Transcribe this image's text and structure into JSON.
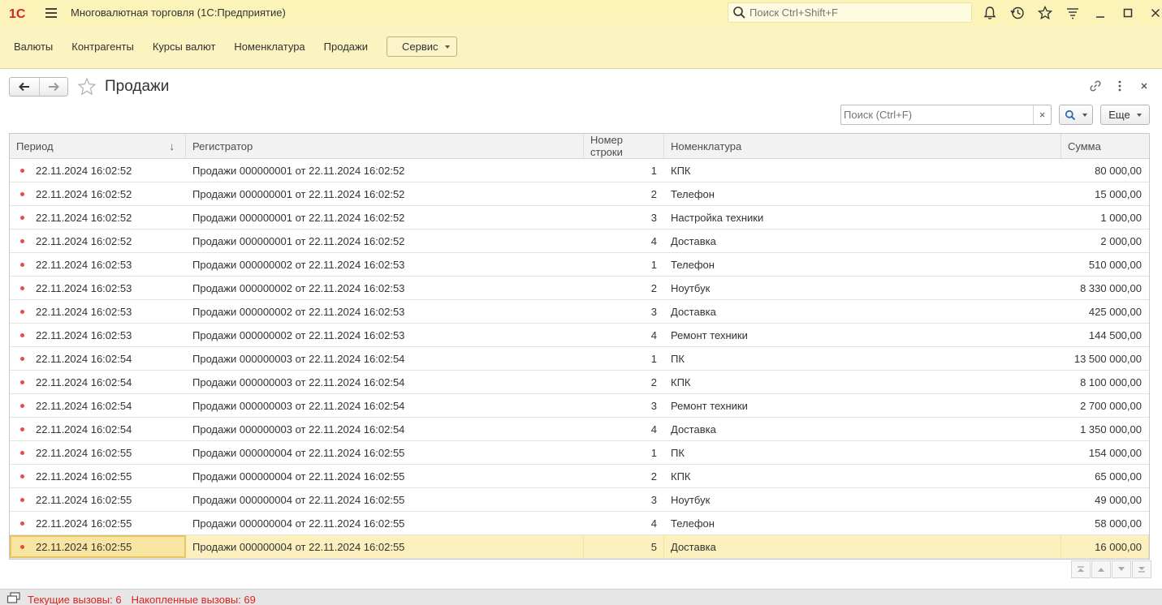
{
  "app": {
    "title": "Многовалютная торговля  (1С:Предприятие)",
    "global_search_placeholder": "Поиск Ctrl+Shift+F",
    "logo_text": "1С"
  },
  "sections": {
    "items": [
      "Валюты",
      "Контрагенты",
      "Курсы валют",
      "Номенклатура",
      "Продажи"
    ],
    "service_label": "Сервис"
  },
  "form": {
    "title": "Продажи",
    "search_placeholder": "Поиск (Ctrl+F)",
    "clear_label": "×",
    "more_label": "Еще"
  },
  "table": {
    "columns": [
      "Период",
      "Регистратор",
      "Номер строки",
      "Номенклатура",
      "Сумма"
    ],
    "sort_indicator": "↓",
    "rows": [
      [
        "22.11.2024 16:02:52",
        "Продажи 000000001 от 22.11.2024 16:02:52",
        "1",
        "КПК",
        "80 000,00"
      ],
      [
        "22.11.2024 16:02:52",
        "Продажи 000000001 от 22.11.2024 16:02:52",
        "2",
        "Телефон",
        "15 000,00"
      ],
      [
        "22.11.2024 16:02:52",
        "Продажи 000000001 от 22.11.2024 16:02:52",
        "3",
        "Настройка техники",
        "1 000,00"
      ],
      [
        "22.11.2024 16:02:52",
        "Продажи 000000001 от 22.11.2024 16:02:52",
        "4",
        "Доставка",
        "2 000,00"
      ],
      [
        "22.11.2024 16:02:53",
        "Продажи 000000002 от 22.11.2024 16:02:53",
        "1",
        "Телефон",
        "510 000,00"
      ],
      [
        "22.11.2024 16:02:53",
        "Продажи 000000002 от 22.11.2024 16:02:53",
        "2",
        "Ноутбук",
        "8 330 000,00"
      ],
      [
        "22.11.2024 16:02:53",
        "Продажи 000000002 от 22.11.2024 16:02:53",
        "3",
        "Доставка",
        "425 000,00"
      ],
      [
        "22.11.2024 16:02:53",
        "Продажи 000000002 от 22.11.2024 16:02:53",
        "4",
        "Ремонт техники",
        "144 500,00"
      ],
      [
        "22.11.2024 16:02:54",
        "Продажи 000000003 от 22.11.2024 16:02:54",
        "1",
        "ПК",
        "13 500 000,00"
      ],
      [
        "22.11.2024 16:02:54",
        "Продажи 000000003 от 22.11.2024 16:02:54",
        "2",
        "КПК",
        "8 100 000,00"
      ],
      [
        "22.11.2024 16:02:54",
        "Продажи 000000003 от 22.11.2024 16:02:54",
        "3",
        "Ремонт техники",
        "2 700 000,00"
      ],
      [
        "22.11.2024 16:02:54",
        "Продажи 000000003 от 22.11.2024 16:02:54",
        "4",
        "Доставка",
        "1 350 000,00"
      ],
      [
        "22.11.2024 16:02:55",
        "Продажи 000000004 от 22.11.2024 16:02:55",
        "1",
        "ПК",
        "154 000,00"
      ],
      [
        "22.11.2024 16:02:55",
        "Продажи 000000004 от 22.11.2024 16:02:55",
        "2",
        "КПК",
        "65 000,00"
      ],
      [
        "22.11.2024 16:02:55",
        "Продажи 000000004 от 22.11.2024 16:02:55",
        "3",
        "Ноутбук",
        "49 000,00"
      ],
      [
        "22.11.2024 16:02:55",
        "Продажи 000000004 от 22.11.2024 16:02:55",
        "4",
        "Телефон",
        "58 000,00"
      ],
      [
        "22.11.2024 16:02:55",
        "Продажи 000000004 от 22.11.2024 16:02:55",
        "5",
        "Доставка",
        "16 000,00"
      ]
    ],
    "selected_row": 16
  },
  "status": {
    "current_calls": "Текущие вызовы: 6",
    "accumulated_calls": "Накопленные вызовы: 69"
  },
  "colors": {
    "accent_yellow": "#fbf3b8",
    "selection": "#fbf0be",
    "record_dot": "#e84a4a",
    "status_red": "#e02020"
  }
}
